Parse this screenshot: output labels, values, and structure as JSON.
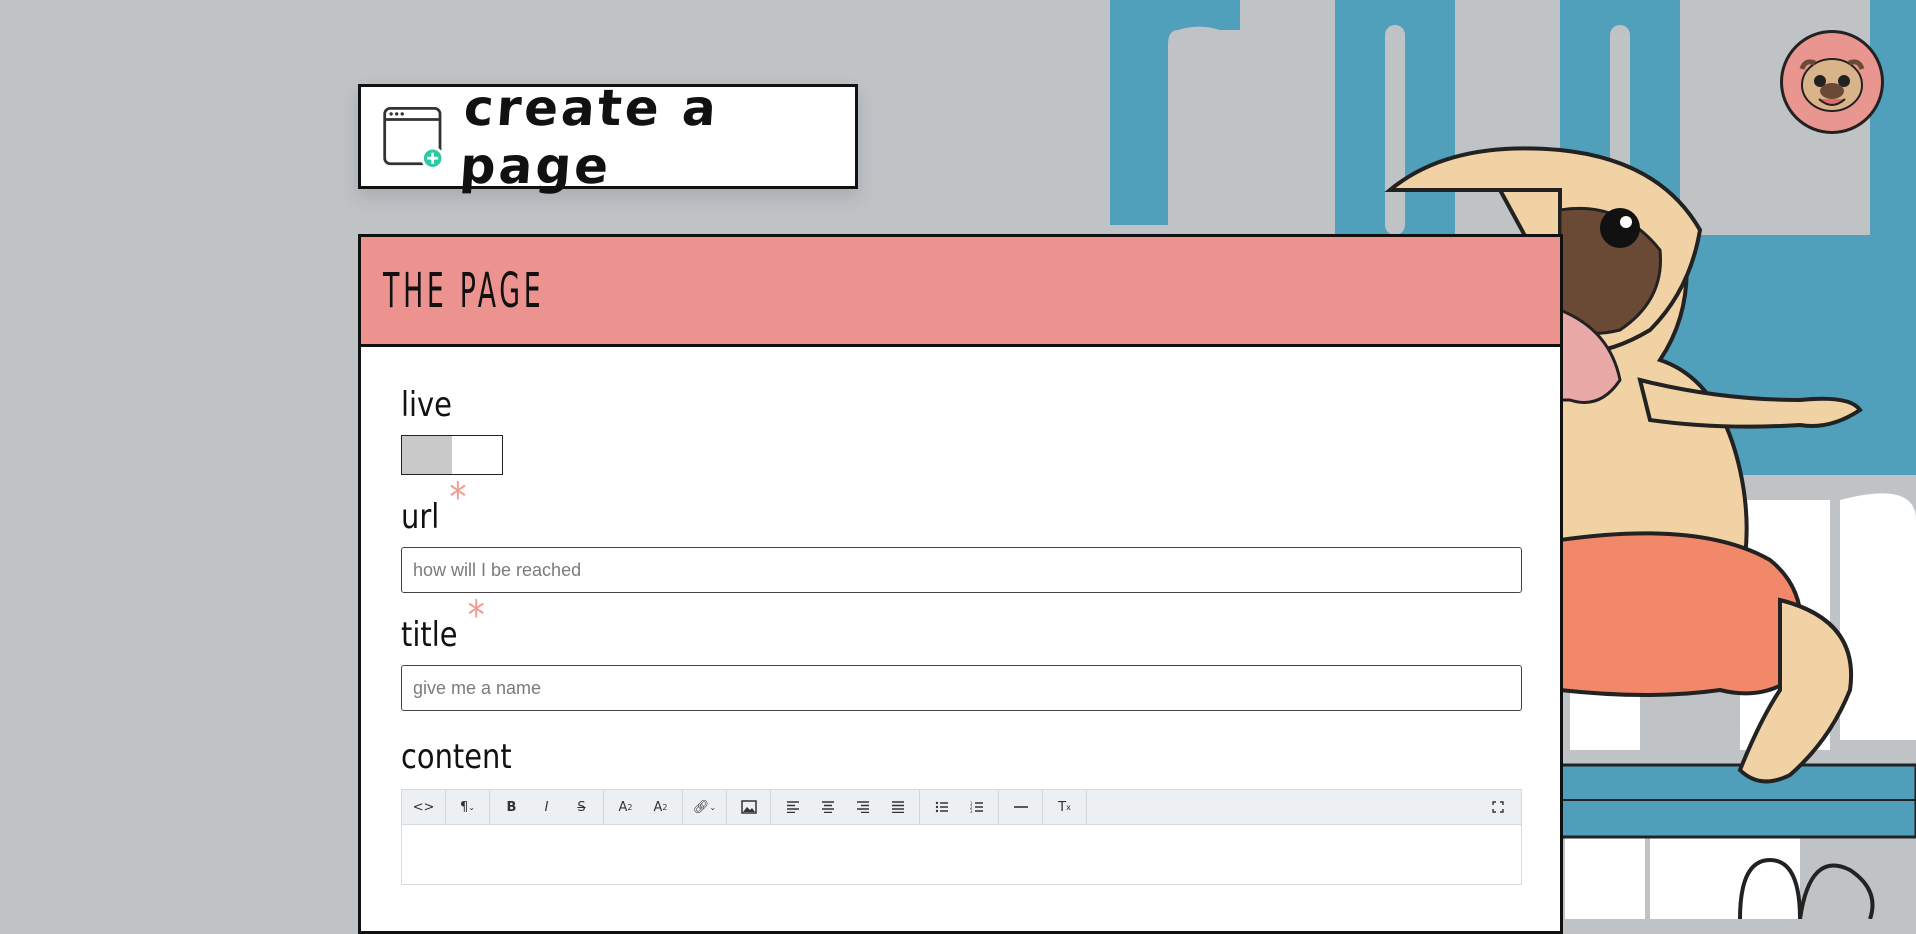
{
  "header": {
    "title": "create a page"
  },
  "form": {
    "section_title": "THE PAGE",
    "live": {
      "label": "live",
      "state": "off"
    },
    "url": {
      "label": "url",
      "required_mark": "*",
      "value": "",
      "placeholder": "how will I be reached"
    },
    "title": {
      "label": "title",
      "required_mark": "*",
      "value": "",
      "placeholder": "give me a name"
    },
    "content": {
      "label": "content"
    }
  },
  "toolbar": {
    "buttons": [
      "code-view-icon",
      "paragraph-format-icon",
      "bold-icon",
      "italic-icon",
      "strikethrough-icon",
      "superscript-icon",
      "subscript-icon",
      "link-icon",
      "image-icon",
      "align-left-icon",
      "align-center-icon",
      "align-right-icon",
      "align-justify-icon",
      "unordered-list-icon",
      "ordered-list-icon",
      "horizontal-rule-icon",
      "clear-formatting-icon",
      "fullscreen-icon"
    ]
  },
  "colors": {
    "page_background": "#bfc3c6",
    "header_band": "#ec938f",
    "required_mark": "#f19a94",
    "bg_text_blue": "#50a0bc",
    "avatar_bg": "#e99590"
  }
}
